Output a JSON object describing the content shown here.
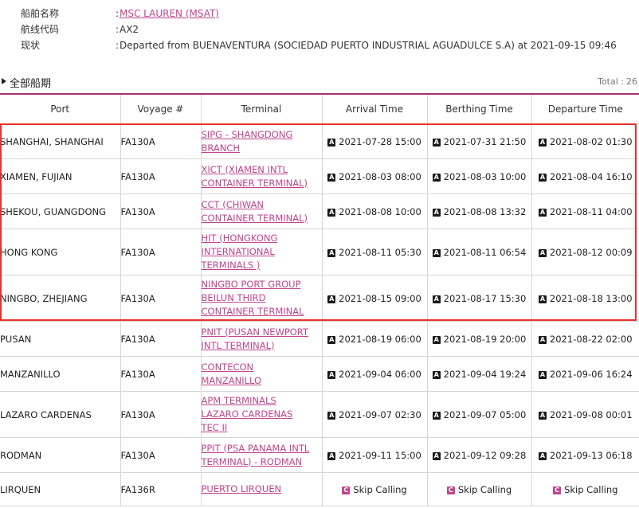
{
  "vessel": {
    "name_label": "船舶名称",
    "name_value": "MSC LAUREN (MSAT)",
    "service_label": "航线代码",
    "service_value": "AX2",
    "status_label": "现状",
    "status_value": "Departed from BUENAVENTURA (SOCIEDAD PUERTO INDUSTRIAL AGUADULCE S.A) at 2021-09-15 09:46",
    "colon": ":"
  },
  "section": {
    "title": "全部船期",
    "total_label": "Total :",
    "total_value": "26"
  },
  "columns": [
    "Port",
    "Voyage #",
    "Terminal",
    "Arrival Time",
    "Berthing Time",
    "Departure Time"
  ],
  "badges": {
    "actual": "A",
    "skip": "C"
  },
  "rows": [
    {
      "port": "SHANGHAI, SHANGHAI",
      "voyage": "FA130A",
      "terminal": [
        "SIPG - SHANGDONG",
        "BRANCH"
      ],
      "arrival": "2021-07-28 15:00",
      "berthing": "2021-07-31 21:50",
      "departure": "2021-08-02 01:30"
    },
    {
      "port": "XIAMEN, FUJIAN",
      "voyage": "FA130A",
      "terminal": [
        "XICT (XIAMEN INTL",
        "CONTAINER TERMINAL)"
      ],
      "arrival": "2021-08-03 08:00",
      "berthing": "2021-08-03 10:00",
      "departure": "2021-08-04 16:10"
    },
    {
      "port": "SHEKOU, GUANGDONG",
      "voyage": "FA130A",
      "terminal": [
        "CCT (CHIWAN",
        "CONTAINER TERMINAL)"
      ],
      "arrival": "2021-08-08 10:00",
      "berthing": "2021-08-08 13:32",
      "departure": "2021-08-11 04:00"
    },
    {
      "port": "HONG KONG",
      "voyage": "FA130A",
      "terminal": [
        "HIT (HONGKONG",
        "INTERNATIONAL",
        "TERMINALS )"
      ],
      "arrival": "2021-08-11 05:30",
      "berthing": "2021-08-11 06:54",
      "departure": "2021-08-12 00:09"
    },
    {
      "port": "NINGBO, ZHEJIANG",
      "voyage": "FA130A",
      "terminal": [
        "NINGBO PORT GROUP",
        "BEILUN THIRD",
        "CONTAINER TERMINAL"
      ],
      "arrival": "2021-08-15 09:00",
      "berthing": "2021-08-17 15:30",
      "departure": "2021-08-18 13:00"
    },
    {
      "port": "PUSAN",
      "voyage": "FA130A",
      "terminal": [
        "PNIT (PUSAN NEWPORT",
        "INTL TERMINAL)"
      ],
      "arrival": "2021-08-19 06:00",
      "berthing": "2021-08-19 20:00",
      "departure": "2021-08-22 02:00"
    },
    {
      "port": "MANZANILLO",
      "voyage": "FA130A",
      "terminal": [
        "CONTECON",
        "MANZANILLO"
      ],
      "arrival": "2021-09-04 06:00",
      "berthing": "2021-09-04 19:24",
      "departure": "2021-09-06 16:24"
    },
    {
      "port": "LAZARO CARDENAS",
      "voyage": "FA130A",
      "terminal": [
        "APM TERMINALS",
        "LAZARO CARDENAS",
        "TEC II"
      ],
      "arrival": "2021-09-07 02:30",
      "berthing": "2021-09-07 05:00",
      "departure": "2021-09-08 00:01"
    },
    {
      "port": "RODMAN",
      "voyage": "FA130A",
      "terminal": [
        "PPIT (PSA PANAMA INTL",
        "TERMINAL) - RODMAN"
      ],
      "arrival": "2021-09-11 15:00",
      "berthing": "2021-09-12 09:28",
      "departure": "2021-09-13 06:18"
    },
    {
      "port": "LIRQUEN",
      "voyage": "FA136R",
      "terminal": [
        "PUERTO LIRQUEN"
      ],
      "arrival": "Skip Calling",
      "berthing": "Skip Calling",
      "departure": "Skip Calling",
      "skip": true
    }
  ],
  "colors": {
    "accent": "#c0458f",
    "header_rule": "#a6307a",
    "highlight": "#e8322a",
    "badge_actual": "#1a1a1a"
  }
}
